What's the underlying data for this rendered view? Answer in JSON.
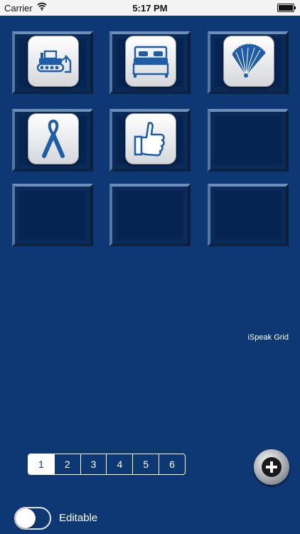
{
  "status_bar": {
    "carrier": "Carrier",
    "time": "5:17 PM"
  },
  "grid": {
    "title": "iSpeak Grid",
    "cells": [
      {
        "icon": "bulldozer-icon"
      },
      {
        "icon": "bed-icon"
      },
      {
        "icon": "hand-fan-icon"
      },
      {
        "icon": "awareness-ribbon-icon"
      },
      {
        "icon": "thumbs-up-icon"
      },
      {
        "icon": ""
      },
      {
        "icon": ""
      },
      {
        "icon": ""
      },
      {
        "icon": ""
      }
    ]
  },
  "pager": {
    "pages": [
      "1",
      "2",
      "3",
      "4",
      "5",
      "6"
    ],
    "selected": "1"
  },
  "toggle": {
    "label": "Editable",
    "on": false
  },
  "colors": {
    "background": "#0d3873",
    "icon_blue": "#1f5da8"
  }
}
